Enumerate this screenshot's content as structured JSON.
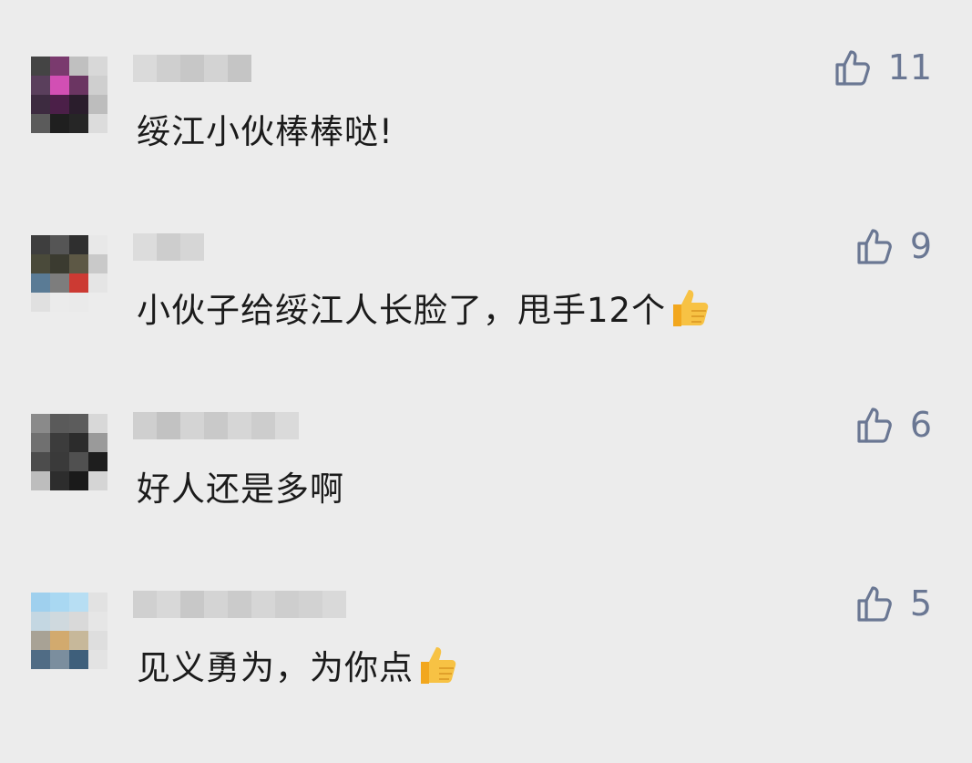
{
  "comments": [
    {
      "text": "绥江小伙棒棒哒!",
      "likes": "11",
      "emoji": false
    },
    {
      "text": "小伙子给绥江人长脸了，甩手12个",
      "likes": "9",
      "emoji": true
    },
    {
      "text": "好人还是多啊",
      "likes": "6",
      "emoji": false
    },
    {
      "text": "见义勇为，为你点",
      "likes": "5",
      "emoji": true
    }
  ],
  "colors": {
    "background": "#ececec",
    "like_icon": "#6a7793",
    "text": "#1b1b1b",
    "thumb_emoji": "#f4b632"
  },
  "icons": {
    "like": "thumbs-up-outline-icon",
    "emoji": "thumbs-up-emoji-icon"
  }
}
